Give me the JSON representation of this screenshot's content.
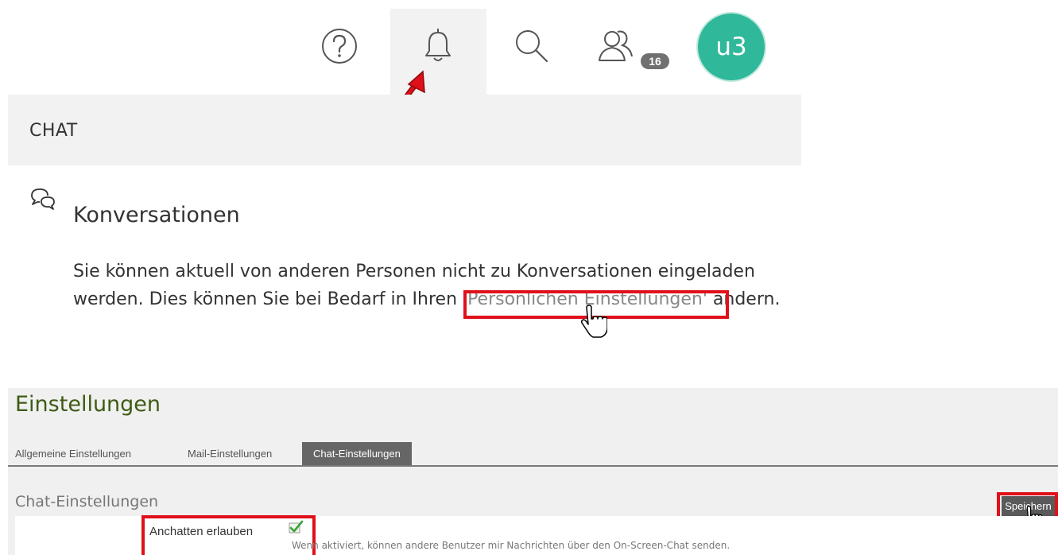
{
  "toolbar": {
    "help_icon": "question-circle-icon",
    "bell_icon": "bell-icon",
    "search_icon": "search-icon",
    "contacts_icon": "contacts-icon",
    "contacts_badge": "16",
    "avatar_initials": "u3",
    "avatar_color": "#2fb89a"
  },
  "chat_header": {
    "title": "CHAT"
  },
  "conversations": {
    "icon": "chat-bubbles-icon",
    "title": "Konversationen",
    "text_before": "Sie können aktuell von anderen Personen nicht zu Konversationen eingeladen werden. Dies können Sie bei Bedarf in Ihren ",
    "link_text": "'Persönlichen Einstellungen'",
    "text_after": " ändern."
  },
  "settings": {
    "title": "Einstellungen",
    "tabs": [
      {
        "label": "Allgemeine Einstellungen",
        "active": false
      },
      {
        "label": "Mail-Einstellungen",
        "active": false
      },
      {
        "label": "Chat-Einstellungen",
        "active": true
      }
    ],
    "section_title": "Chat-Einstellungen",
    "save_label": "Speichern",
    "option": {
      "label": "Anchatten erlauben",
      "checked": true,
      "description": "Wenn aktiviert, können andere Benutzer mir Nachrichten über den On-Screen-Chat senden."
    }
  },
  "annotation_color": "#e0101a"
}
